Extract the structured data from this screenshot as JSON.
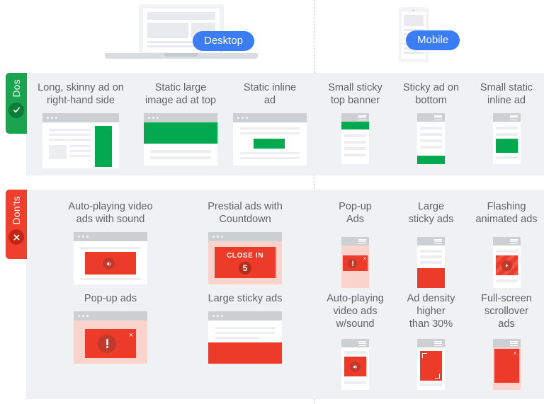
{
  "header": {
    "desktop_label": "Desktop",
    "mobile_label": "Mobile",
    "pill_color": "#3b7df6"
  },
  "tabs": {
    "dos": {
      "label": "Dos",
      "icon": "check-icon",
      "color": "#1aa44f",
      "badge_color": "#0c7c39"
    },
    "donts": {
      "label": "Don'ts",
      "icon": "close-icon",
      "color": "#f0402d",
      "badge_color": "#c32512"
    }
  },
  "colors": {
    "good": "#03a94f",
    "bad": "#ed3b2a",
    "panel": "#eff1f2",
    "text": "#5f6368"
  },
  "sections": {
    "dos": {
      "desktop": [
        {
          "title": "Long, skinny ad on\nright-hand side"
        },
        {
          "title": "Static large\nimage ad at top"
        },
        {
          "title": "Static inline\nad"
        }
      ],
      "mobile": [
        {
          "title": "Small sticky\ntop banner"
        },
        {
          "title": "Sticky ad on\nbottom"
        },
        {
          "title": "Small static\ninline ad"
        }
      ]
    },
    "donts": {
      "desktop_row1": [
        {
          "title": "Auto-playing video\nads with sound",
          "icon": "sound-icon"
        },
        {
          "title": "Prestial ads with\nCountdown",
          "overlay_text": "CLOSE IN",
          "countdown": "5"
        }
      ],
      "desktop_row2": [
        {
          "title": "Pop-up ads",
          "icon": "alert-icon",
          "close": "×"
        },
        {
          "title": "Large sticky ads"
        }
      ],
      "mobile_row1": [
        {
          "title": "Pop-up\nAds",
          "icon": "alert-icon",
          "close": "×"
        },
        {
          "title": "Large\nsticky ads"
        },
        {
          "title": "Flashing\nanimated ads",
          "icon": "play-icon"
        }
      ],
      "mobile_row2": [
        {
          "title": "Auto-playing\nvideo ads\nw/sound",
          "icon": "sound-icon"
        },
        {
          "title": "Ad density\nhigher\nthan 30%"
        },
        {
          "title": "Full-screen\nscrollover\nads",
          "close": "×"
        }
      ]
    }
  }
}
